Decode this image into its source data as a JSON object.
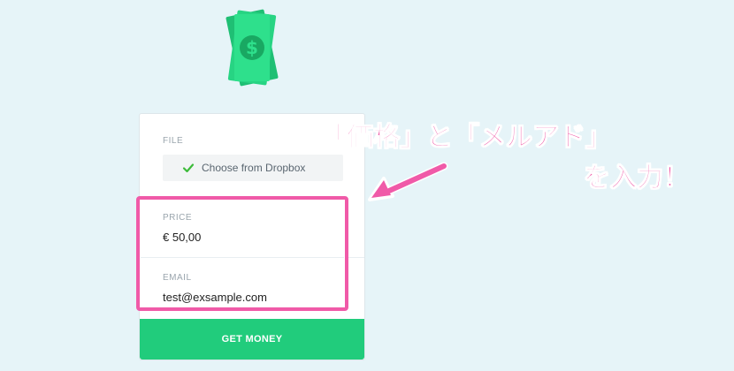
{
  "form": {
    "file_label": "FILE",
    "dropbox_label": "Choose from Dropbox",
    "price_label": "PRICE",
    "price_value": "€ 50,00",
    "email_label": "EMAIL",
    "email_value": "test@exsample.com",
    "submit_label": "GET MONEY"
  },
  "annotation": {
    "line1": "「価格」と「メルアド」",
    "line2": "を入力！"
  },
  "colors": {
    "accent_green": "#21cc7c",
    "annotation_pink": "#f05aa8",
    "background": "#e6f4f8"
  },
  "icons": {
    "logo": "money-bill-icon",
    "check": "check-icon",
    "arrow": "arrow-icon"
  }
}
